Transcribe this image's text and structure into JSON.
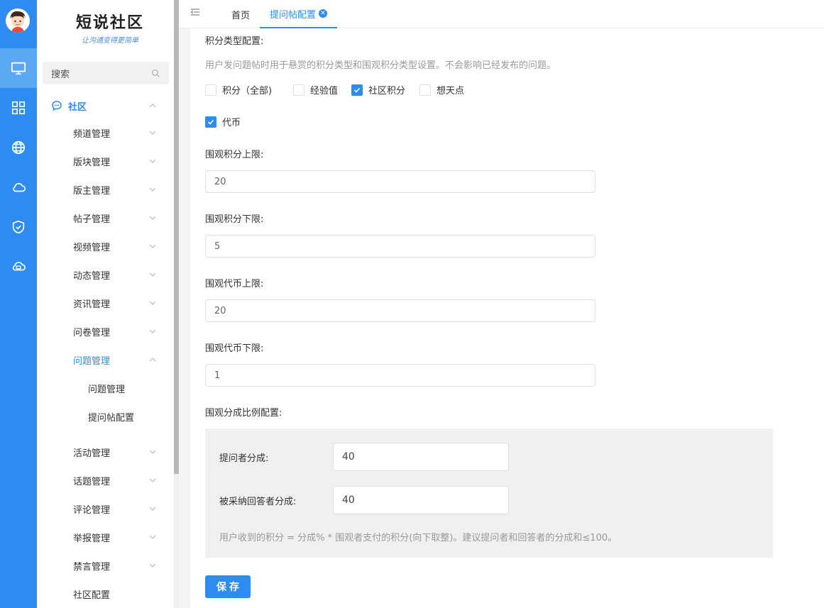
{
  "app": {
    "logo_title": "短说社区",
    "logo_subtitle": "让沟通变得更简单",
    "accent": "#2d8cf0"
  },
  "rail": {
    "items": [
      {
        "icon": "monitor-icon",
        "active": true
      },
      {
        "icon": "grid-icon",
        "active": false
      },
      {
        "icon": "globe-icon",
        "active": false
      },
      {
        "icon": "cloud-icon",
        "active": false
      },
      {
        "icon": "shield-icon",
        "active": false
      },
      {
        "icon": "cloud-network-icon",
        "active": false
      }
    ]
  },
  "sidebar": {
    "search_label": "搜索",
    "section_label": "社区",
    "items": [
      {
        "label": "频道管理"
      },
      {
        "label": "版块管理"
      },
      {
        "label": "版主管理"
      },
      {
        "label": "帖子管理"
      },
      {
        "label": "视频管理"
      },
      {
        "label": "动态管理"
      },
      {
        "label": "资讯管理"
      },
      {
        "label": "问卷管理"
      },
      {
        "label": "问题管理"
      },
      {
        "label": "活动管理"
      },
      {
        "label": "话题管理"
      },
      {
        "label": "评论管理"
      },
      {
        "label": "举报管理"
      },
      {
        "label": "禁言管理"
      },
      {
        "label": "社区配置"
      }
    ],
    "sub_items": [
      {
        "label": "问题管理"
      },
      {
        "label": "提问帖配置"
      }
    ]
  },
  "tabs": {
    "home": "首页",
    "active": "提问帖配置"
  },
  "form": {
    "type_title": "积分类型配置:",
    "type_desc": "用户发问题帖时用于悬赏的积分类型和围观积分类型设置。不会影响已经发布的问题。",
    "options": [
      {
        "label": "积分（全部)",
        "checked": false
      },
      {
        "label": "经验值",
        "checked": false
      },
      {
        "label": "社区积分",
        "checked": true
      },
      {
        "label": "想天点",
        "checked": false
      },
      {
        "label": "代币",
        "checked": true
      }
    ],
    "score_max_label": "围观积分上限:",
    "score_max_value": "20",
    "score_min_label": "围观积分下限:",
    "score_min_value": "5",
    "coin_max_label": "围观代币上限:",
    "coin_max_value": "20",
    "coin_min_label": "围观代币下限:",
    "coin_min_value": "1",
    "ratio_title": "围观分成比例配置:",
    "asker_label": "提问者分成:",
    "asker_value": "40",
    "answerer_label": "被采纳回答者分成:",
    "answerer_value": "40",
    "ratio_note": "用户收到的积分 = 分成% * 围观者支付的积分(向下取整)。建议提问者和回答者的分成和≤100。",
    "save_label": "保存"
  }
}
